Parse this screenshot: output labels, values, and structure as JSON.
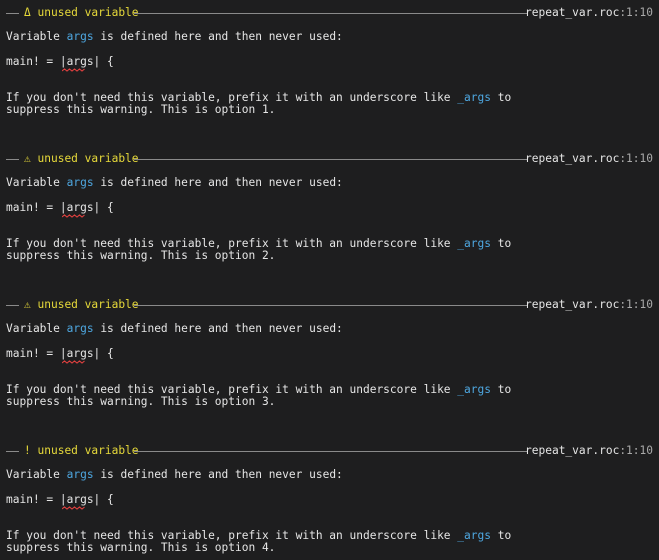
{
  "colors": {
    "background": "#1e1e1f",
    "text": "#e6e6e6",
    "warning_title": "#e6d93a",
    "identifier": "#4ea7e0",
    "squiggle": "#e0403f",
    "rule": "#8a8a8a"
  },
  "warnings": [
    {
      "icon": "Δ",
      "title": "unused variable",
      "file": "repeat_var.roc",
      "position": ":1:10",
      "msg_before": "Variable ",
      "msg_ident": "args",
      "msg_after": " is defined here and then never used:",
      "code": "main! = |args| {",
      "hint1_before": "If you don't need this variable, prefix it with an underscore like ",
      "hint1_ident": "_args",
      "hint1_after": " to",
      "hint2": "suppress this warning. This is option 1."
    },
    {
      "icon": "⚠",
      "title": "unused variable",
      "file": "repeat_var.roc",
      "position": ":1:10",
      "msg_before": "Variable ",
      "msg_ident": "args",
      "msg_after": " is defined here and then never used:",
      "code": "main! = |args| {",
      "hint1_before": "If you don't need this variable, prefix it with an underscore like ",
      "hint1_ident": "_args",
      "hint1_after": " to",
      "hint2": "suppress this warning. This is option 2."
    },
    {
      "icon": "⚠",
      "title": "unused variable",
      "file": "repeat_var.roc",
      "position": ":1:10",
      "msg_before": "Variable ",
      "msg_ident": "args",
      "msg_after": " is defined here and then never used:",
      "code": "main! = |args| {",
      "hint1_before": "If you don't need this variable, prefix it with an underscore like ",
      "hint1_ident": "_args",
      "hint1_after": " to",
      "hint2": "suppress this warning. This is option 3."
    },
    {
      "icon": "!",
      "title": "unused variable",
      "file": "repeat_var.roc",
      "position": ":1:10",
      "msg_before": "Variable ",
      "msg_ident": "args",
      "msg_after": " is defined here and then never used:",
      "code": "main! = |args| {",
      "hint1_before": "If you don't need this variable, prefix it with an underscore like ",
      "hint1_ident": "_args",
      "hint1_after": " to",
      "hint2": "suppress this warning. This is option 4."
    }
  ]
}
